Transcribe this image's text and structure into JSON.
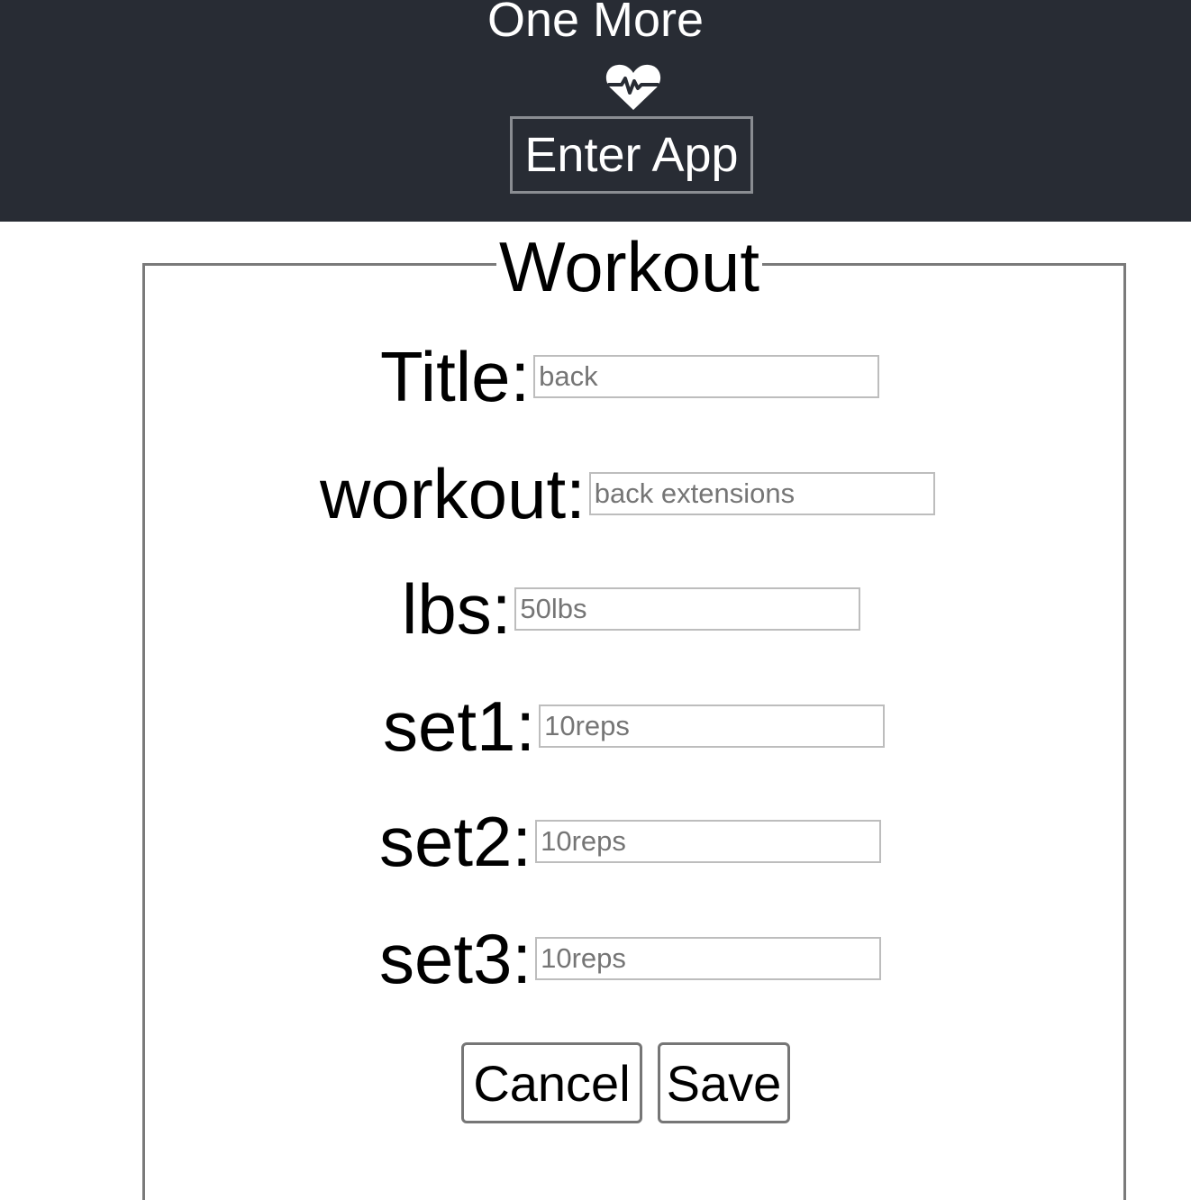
{
  "header": {
    "app_title": "One More",
    "logo_icon": "heartbeat-icon",
    "enter_button_label": "Enter App",
    "background_color": "#282c34"
  },
  "form": {
    "legend": "Workout",
    "fields": [
      {
        "label": "Title:",
        "placeholder": "back"
      },
      {
        "label": "workout:",
        "placeholder": "back extensions"
      },
      {
        "label": "lbs:",
        "placeholder": "50lbs"
      },
      {
        "label": "set1:",
        "placeholder": "10reps"
      },
      {
        "label": "set2:",
        "placeholder": "10reps"
      },
      {
        "label": "set3:",
        "placeholder": "10reps"
      }
    ],
    "cancel_label": "Cancel",
    "save_label": "Save"
  }
}
